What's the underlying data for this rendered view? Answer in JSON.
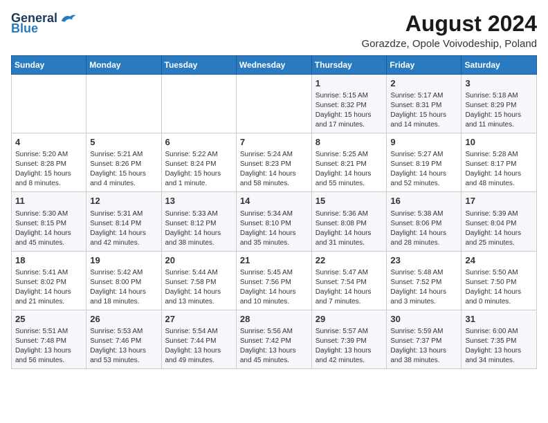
{
  "header": {
    "logo": {
      "general": "General",
      "blue": "Blue"
    },
    "title": "August 2024",
    "subtitle": "Gorazdze, Opole Voivodeship, Poland"
  },
  "calendar": {
    "days_of_week": [
      "Sunday",
      "Monday",
      "Tuesday",
      "Wednesday",
      "Thursday",
      "Friday",
      "Saturday"
    ],
    "weeks": [
      [
        {
          "day": "",
          "info": ""
        },
        {
          "day": "",
          "info": ""
        },
        {
          "day": "",
          "info": ""
        },
        {
          "day": "",
          "info": ""
        },
        {
          "day": "1",
          "info": "Sunrise: 5:15 AM\nSunset: 8:32 PM\nDaylight: 15 hours and 17 minutes."
        },
        {
          "day": "2",
          "info": "Sunrise: 5:17 AM\nSunset: 8:31 PM\nDaylight: 15 hours and 14 minutes."
        },
        {
          "day": "3",
          "info": "Sunrise: 5:18 AM\nSunset: 8:29 PM\nDaylight: 15 hours and 11 minutes."
        }
      ],
      [
        {
          "day": "4",
          "info": "Sunrise: 5:20 AM\nSunset: 8:28 PM\nDaylight: 15 hours and 8 minutes."
        },
        {
          "day": "5",
          "info": "Sunrise: 5:21 AM\nSunset: 8:26 PM\nDaylight: 15 hours and 4 minutes."
        },
        {
          "day": "6",
          "info": "Sunrise: 5:22 AM\nSunset: 8:24 PM\nDaylight: 15 hours and 1 minute."
        },
        {
          "day": "7",
          "info": "Sunrise: 5:24 AM\nSunset: 8:23 PM\nDaylight: 14 hours and 58 minutes."
        },
        {
          "day": "8",
          "info": "Sunrise: 5:25 AM\nSunset: 8:21 PM\nDaylight: 14 hours and 55 minutes."
        },
        {
          "day": "9",
          "info": "Sunrise: 5:27 AM\nSunset: 8:19 PM\nDaylight: 14 hours and 52 minutes."
        },
        {
          "day": "10",
          "info": "Sunrise: 5:28 AM\nSunset: 8:17 PM\nDaylight: 14 hours and 48 minutes."
        }
      ],
      [
        {
          "day": "11",
          "info": "Sunrise: 5:30 AM\nSunset: 8:15 PM\nDaylight: 14 hours and 45 minutes."
        },
        {
          "day": "12",
          "info": "Sunrise: 5:31 AM\nSunset: 8:14 PM\nDaylight: 14 hours and 42 minutes."
        },
        {
          "day": "13",
          "info": "Sunrise: 5:33 AM\nSunset: 8:12 PM\nDaylight: 14 hours and 38 minutes."
        },
        {
          "day": "14",
          "info": "Sunrise: 5:34 AM\nSunset: 8:10 PM\nDaylight: 14 hours and 35 minutes."
        },
        {
          "day": "15",
          "info": "Sunrise: 5:36 AM\nSunset: 8:08 PM\nDaylight: 14 hours and 31 minutes."
        },
        {
          "day": "16",
          "info": "Sunrise: 5:38 AM\nSunset: 8:06 PM\nDaylight: 14 hours and 28 minutes."
        },
        {
          "day": "17",
          "info": "Sunrise: 5:39 AM\nSunset: 8:04 PM\nDaylight: 14 hours and 25 minutes."
        }
      ],
      [
        {
          "day": "18",
          "info": "Sunrise: 5:41 AM\nSunset: 8:02 PM\nDaylight: 14 hours and 21 minutes."
        },
        {
          "day": "19",
          "info": "Sunrise: 5:42 AM\nSunset: 8:00 PM\nDaylight: 14 hours and 18 minutes."
        },
        {
          "day": "20",
          "info": "Sunrise: 5:44 AM\nSunset: 7:58 PM\nDaylight: 14 hours and 13 minutes."
        },
        {
          "day": "21",
          "info": "Sunrise: 5:45 AM\nSunset: 7:56 PM\nDaylight: 14 hours and 10 minutes."
        },
        {
          "day": "22",
          "info": "Sunrise: 5:47 AM\nSunset: 7:54 PM\nDaylight: 14 hours and 7 minutes."
        },
        {
          "day": "23",
          "info": "Sunrise: 5:48 AM\nSunset: 7:52 PM\nDaylight: 14 hours and 3 minutes."
        },
        {
          "day": "24",
          "info": "Sunrise: 5:50 AM\nSunset: 7:50 PM\nDaylight: 14 hours and 0 minutes."
        }
      ],
      [
        {
          "day": "25",
          "info": "Sunrise: 5:51 AM\nSunset: 7:48 PM\nDaylight: 13 hours and 56 minutes."
        },
        {
          "day": "26",
          "info": "Sunrise: 5:53 AM\nSunset: 7:46 PM\nDaylight: 13 hours and 53 minutes."
        },
        {
          "day": "27",
          "info": "Sunrise: 5:54 AM\nSunset: 7:44 PM\nDaylight: 13 hours and 49 minutes."
        },
        {
          "day": "28",
          "info": "Sunrise: 5:56 AM\nSunset: 7:42 PM\nDaylight: 13 hours and 45 minutes."
        },
        {
          "day": "29",
          "info": "Sunrise: 5:57 AM\nSunset: 7:39 PM\nDaylight: 13 hours and 42 minutes."
        },
        {
          "day": "30",
          "info": "Sunrise: 5:59 AM\nSunset: 7:37 PM\nDaylight: 13 hours and 38 minutes."
        },
        {
          "day": "31",
          "info": "Sunrise: 6:00 AM\nSunset: 7:35 PM\nDaylight: 13 hours and 34 minutes."
        }
      ]
    ]
  }
}
